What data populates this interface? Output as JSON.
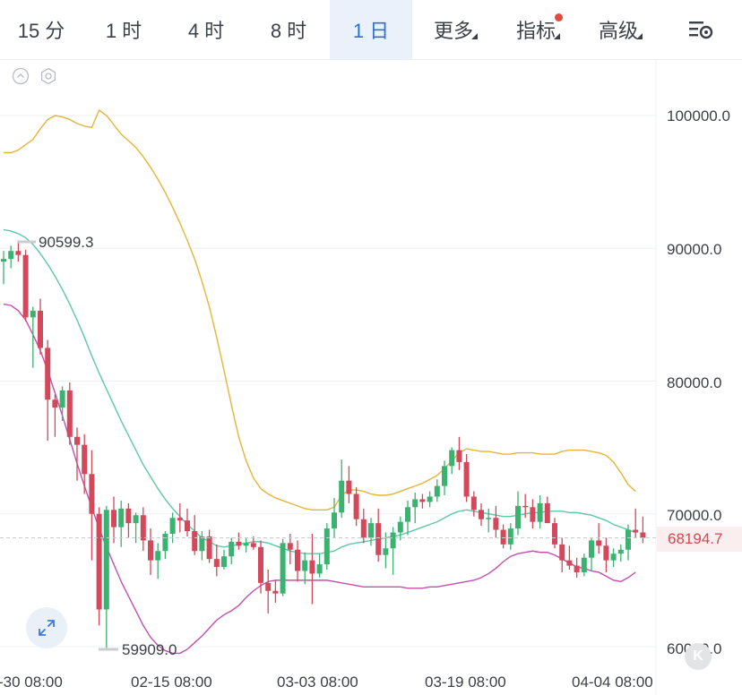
{
  "toolbar": {
    "tabs": [
      {
        "label": "15 分",
        "active": false,
        "dropdown": false
      },
      {
        "label": "1 时",
        "active": false,
        "dropdown": false
      },
      {
        "label": "4 时",
        "active": false,
        "dropdown": false
      },
      {
        "label": "8 时",
        "active": false,
        "dropdown": false
      },
      {
        "label": "1 日",
        "active": true,
        "dropdown": false
      },
      {
        "label": "更多",
        "active": false,
        "dropdown": true
      },
      {
        "label": "指标",
        "active": false,
        "dropdown": true,
        "badge": true
      },
      {
        "label": "高级",
        "active": false,
        "dropdown": true
      }
    ],
    "settings_icon": "chart-settings-icon"
  },
  "chart": {
    "collapse_icon": "chevron-up-circle-icon",
    "settings_icon": "hexagon-settings-icon",
    "high_annotation": "90599.3",
    "low_annotation": "59909.0",
    "current_price": "68194.7",
    "expand_icon": "expand-arrows-icon",
    "logo_icon": "k-logo-icon",
    "logo_text": "K"
  },
  "chart_data": {
    "type": "candlestick",
    "y_ticks": [
      "100000.0",
      "90000.0",
      "80000.0",
      "70000.0",
      "60000.0"
    ],
    "x_ticks": [
      "-30 08:00",
      "02-15 08:00",
      "03-03 08:00",
      "03-19 08:00",
      "04-04 08:00"
    ],
    "ylim": [
      58500,
      104200
    ],
    "current_price": 68194.7,
    "colors": {
      "up": "#3cb271",
      "down": "#d3485a",
      "upper_band": "#e5b53a",
      "middle_band": "#5ec8a6",
      "lower_band": "#c34fae"
    },
    "candles": [
      [
        89000,
        89800,
        87300,
        89200
      ],
      [
        89200,
        90200,
        88500,
        89800
      ],
      [
        89800,
        90599.3,
        89000,
        89500
      ],
      [
        89500,
        89900,
        84500,
        84800
      ],
      [
        84800,
        85600,
        81000,
        85300
      ],
      [
        85300,
        86200,
        82000,
        82500
      ],
      [
        82500,
        83100,
        75500,
        78600
      ],
      [
        78600,
        79000,
        75800,
        78000
      ],
      [
        78000,
        79600,
        77000,
        79300
      ],
      [
        79300,
        79900,
        75200,
        75800
      ],
      [
        75800,
        76500,
        72500,
        75200
      ],
      [
        75200,
        76000,
        71500,
        73000
      ],
      [
        73000,
        74800,
        66500,
        70000
      ],
      [
        70000,
        70500,
        61600,
        62800
      ],
      [
        62800,
        70600,
        59909,
        70300
      ],
      [
        70300,
        71300,
        67800,
        69000
      ],
      [
        69000,
        71000,
        67500,
        70400
      ],
      [
        70400,
        70800,
        68200,
        69300
      ],
      [
        69300,
        70100,
        67800,
        69900
      ],
      [
        69900,
        70500,
        67200,
        68000
      ],
      [
        68000,
        68900,
        65400,
        66500
      ],
      [
        66500,
        67800,
        65100,
        67200
      ],
      [
        67200,
        68700,
        66600,
        68500
      ],
      [
        68500,
        70100,
        67800,
        69700
      ],
      [
        69700,
        70800,
        68600,
        69500
      ],
      [
        69500,
        70400,
        68300,
        68700
      ],
      [
        68700,
        69900,
        66900,
        67200
      ],
      [
        67200,
        68700,
        66500,
        68300
      ],
      [
        68300,
        68800,
        66300,
        66600
      ],
      [
        66600,
        67700,
        65300,
        66000
      ],
      [
        66000,
        67300,
        65800,
        66800
      ],
      [
        66800,
        68200,
        66200,
        67900
      ],
      [
        67900,
        68600,
        67300,
        67600
      ],
      [
        67600,
        68200,
        67100,
        67800
      ],
      [
        67800,
        68300,
        67300,
        67500
      ],
      [
        67500,
        68000,
        64000,
        64800
      ],
      [
        64800,
        65800,
        62500,
        64200
      ],
      [
        64200,
        65000,
        63300,
        64000
      ],
      [
        64000,
        68100,
        63800,
        67800
      ],
      [
        67800,
        68500,
        66200,
        67300
      ],
      [
        67300,
        68000,
        64900,
        65700
      ],
      [
        65700,
        67100,
        64700,
        66500
      ],
      [
        66500,
        68500,
        63200,
        65500
      ],
      [
        65500,
        67000,
        65200,
        66200
      ],
      [
        66200,
        69300,
        65800,
        68900
      ],
      [
        68900,
        71200,
        68200,
        70100
      ],
      [
        70100,
        74100,
        69700,
        72500
      ],
      [
        72500,
        73600,
        70800,
        71500
      ],
      [
        71500,
        72000,
        69100,
        69600
      ],
      [
        69600,
        70400,
        67800,
        68200
      ],
      [
        68200,
        69700,
        67600,
        69300
      ],
      [
        69300,
        70400,
        66400,
        66900
      ],
      [
        66900,
        68600,
        65900,
        67400
      ],
      [
        67400,
        69000,
        65400,
        68600
      ],
      [
        68600,
        69800,
        68000,
        69400
      ],
      [
        69400,
        71000,
        68400,
        70500
      ],
      [
        70500,
        71600,
        69300,
        71100
      ],
      [
        71100,
        71500,
        70400,
        70900
      ],
      [
        70900,
        71700,
        70500,
        71300
      ],
      [
        71300,
        72600,
        70900,
        72100
      ],
      [
        72100,
        74000,
        71400,
        73600
      ],
      [
        73600,
        75000,
        73000,
        74800
      ],
      [
        74800,
        75800,
        73300,
        73900
      ],
      [
        73900,
        74500,
        70900,
        71300
      ],
      [
        71300,
        71700,
        69800,
        70300
      ],
      [
        70300,
        70800,
        69100,
        69600
      ],
      [
        69600,
        70400,
        68600,
        69700
      ],
      [
        69700,
        70600,
        68200,
        68800
      ],
      [
        68800,
        69200,
        67400,
        67700
      ],
      [
        67700,
        69300,
        67300,
        68900
      ],
      [
        68900,
        71700,
        68400,
        70600
      ],
      [
        70600,
        71500,
        69700,
        70500
      ],
      [
        70500,
        71100,
        68900,
        69400
      ],
      [
        69400,
        71400,
        68900,
        70800
      ],
      [
        70800,
        71300,
        69600,
        69300
      ],
      [
        69300,
        69700,
        67400,
        67700
      ],
      [
        67700,
        68200,
        65600,
        66500
      ],
      [
        66500,
        67600,
        65800,
        66100
      ],
      [
        66100,
        66700,
        65200,
        65600
      ],
      [
        65600,
        67000,
        65300,
        66700
      ],
      [
        66700,
        68200,
        65700,
        68000
      ],
      [
        68000,
        69300,
        67000,
        67600
      ],
      [
        67600,
        68200,
        65600,
        66500
      ],
      [
        66500,
        67400,
        66000,
        67000
      ],
      [
        67000,
        67700,
        66400,
        67300
      ],
      [
        67300,
        69200,
        66500,
        68800
      ],
      [
        68800,
        70400,
        68200,
        68600
      ],
      [
        68600,
        69800,
        67800,
        68194.7
      ]
    ],
    "upper_band": [
      97200,
      97200,
      97400,
      97800,
      98200,
      99000,
      99700,
      100000,
      99900,
      99700,
      99400,
      99200,
      99100,
      100400,
      100000,
      99300,
      98600,
      98100,
      97600,
      96900,
      96100,
      95200,
      94200,
      93100,
      91900,
      90600,
      89200,
      87500,
      85600,
      83300,
      80800,
      78200,
      75800,
      74000,
      72700,
      71900,
      71500,
      71200,
      71000,
      70800,
      70600,
      70400,
      70300,
      70300,
      70300,
      70500,
      71400,
      71800,
      71800,
      71700,
      71500,
      71400,
      71400,
      71500,
      71700,
      71900,
      72100,
      72300,
      72600,
      72900,
      73400,
      74000,
      74600,
      74900,
      74800,
      74700,
      74700,
      74600,
      74500,
      74500,
      74600,
      74600,
      74600,
      74500,
      74500,
      74500,
      74700,
      74800,
      74800,
      74800,
      74700,
      74600,
      74400,
      73900,
      73100,
      72200,
      71700
    ],
    "middle_band": [
      91400,
      91300,
      91100,
      90800,
      90300,
      89600,
      88800,
      87900,
      86900,
      85800,
      84600,
      83300,
      81900,
      80600,
      79400,
      78200,
      77000,
      75900,
      74800,
      73700,
      72800,
      71900,
      71100,
      70400,
      69800,
      69200,
      68700,
      68200,
      67900,
      67600,
      67500,
      67600,
      67700,
      67800,
      67900,
      67900,
      67800,
      67600,
      67400,
      67200,
      67100,
      67000,
      67000,
      67000,
      67100,
      67200,
      67500,
      67700,
      67800,
      67900,
      68000,
      68100,
      68200,
      68300,
      68400,
      68600,
      68800,
      69000,
      69200,
      69400,
      69700,
      70000,
      70200,
      70300,
      70200,
      70100,
      70000,
      69900,
      69800,
      69800,
      69900,
      70000,
      70100,
      70100,
      70200,
      70200,
      70200,
      70100,
      70100,
      70000,
      69900,
      69700,
      69500,
      69200,
      69000,
      68800,
      68600
    ],
    "lower_band": [
      85800,
      85700,
      85300,
      84600,
      83500,
      82300,
      80800,
      79100,
      77400,
      75600,
      73800,
      72100,
      70500,
      68900,
      67500,
      66200,
      64900,
      63800,
      62700,
      61600,
      60700,
      60100,
      59700,
      59500,
      59500,
      59800,
      60300,
      60800,
      61400,
      62000,
      62400,
      62700,
      63100,
      63700,
      64200,
      64600,
      64900,
      65000,
      65000,
      65000,
      65000,
      65000,
      65000,
      65000,
      65000,
      64900,
      64800,
      64700,
      64600,
      64500,
      64500,
      64500,
      64500,
      64500,
      64500,
      64400,
      64400,
      64400,
      64500,
      64500,
      64600,
      64700,
      64800,
      64900,
      65000,
      65200,
      65500,
      65900,
      66400,
      66800,
      67000,
      67100,
      67200,
      67100,
      67100,
      66900,
      66600,
      66300,
      66000,
      65900,
      65700,
      65600,
      65300,
      65000,
      64900,
      65200,
      65600
    ]
  }
}
